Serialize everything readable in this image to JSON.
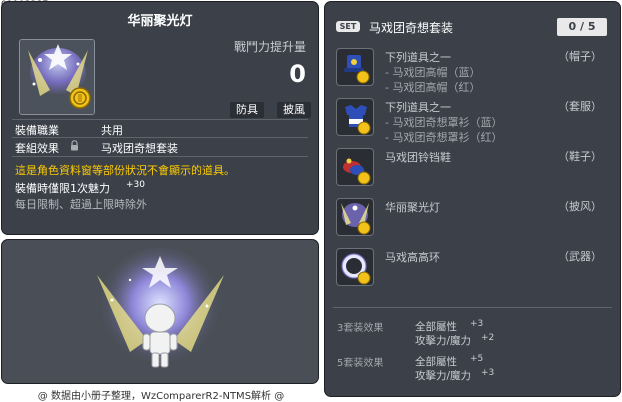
{
  "code": "01103287",
  "item": {
    "name": "华丽聚光灯",
    "power_label": "戰鬥力提升量",
    "power_value": "0",
    "tags": [
      "防具",
      "披風"
    ],
    "job_label": "裝備職業",
    "job_value": "共用",
    "set_label": "套組效果",
    "set_value": "马戏团奇想套装",
    "warning": "這是角色資料窗等部份狀況不會顯示的道具。",
    "charm_label": "裝備時僅限1次魅力",
    "charm_value": "+30",
    "limit_text": "每日限制、超過上限時除外"
  },
  "footer": "@ 数据由小册子整理，WzComparerR2-NTMS解析 @",
  "set": {
    "badge": "SET",
    "name": "马戏团奇想套装",
    "count": "0 / 5",
    "items": [
      {
        "name": "下列道具之一",
        "sub1": "- 马戏团高帽（蓝）",
        "sub2": "- 马戏团高帽（红）",
        "category": "（帽子）",
        "icon": "circus-hat-icon"
      },
      {
        "name": "下列道具之一",
        "sub1": "- 马戏团奇想罩衫（蓝）",
        "sub2": "- 马戏团奇想罩衫（红）",
        "category": "（套服）",
        "icon": "circus-overall-icon"
      },
      {
        "name": "马戏团铃铛鞋",
        "category": "（鞋子）",
        "icon": "bell-shoes-icon"
      },
      {
        "name": "华丽聚光灯",
        "category": "（披风）",
        "icon": "spotlight-cape-icon"
      },
      {
        "name": "马戏高高环",
        "category": "（武器）",
        "icon": "circus-ring-icon"
      }
    ],
    "bonuses": [
      {
        "label": "3套装效果",
        "stat1": "全部屬性",
        "val1": "+3",
        "stat2": "攻擊力/魔力",
        "val2": "+2"
      },
      {
        "label": "5套装效果",
        "stat1": "全部屬性",
        "val1": "+5",
        "stat2": "攻擊力/魔力",
        "val2": "+3"
      }
    ]
  },
  "colors": {
    "panel_bg": "#3b4049",
    "warning": "#ffcc00",
    "coin": "#f2c21b"
  }
}
